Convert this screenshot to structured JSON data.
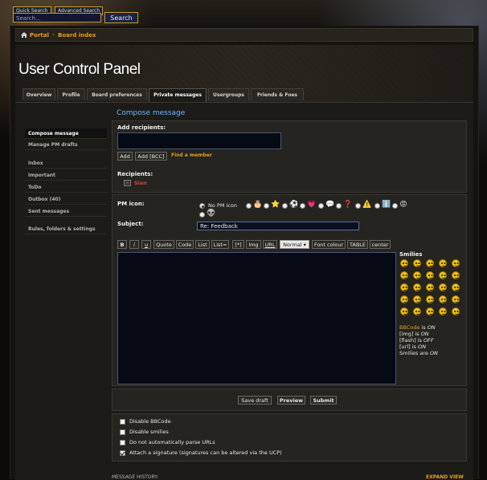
{
  "top": {
    "quick_search": "Quick Search",
    "advanced_search": "Advanced Search",
    "search_placeholder": "Search...",
    "search_button": "Search"
  },
  "breadcrumb": {
    "portal": "Portal",
    "board_index": "Board index",
    "separator": "›"
  },
  "page_title": "User Control Panel",
  "tabs": [
    "Overview",
    "Profile",
    "Board preferences",
    "Private messages",
    "Usergroups",
    "Friends & Foes"
  ],
  "section_title": "Compose message",
  "menu": {
    "compose": "Compose message",
    "manage_drafts": "Manage PM drafts",
    "inbox": "Inbox",
    "important": "Important",
    "todo": "ToDo",
    "outbox": "Outbox (40)",
    "sent": "Sent messages",
    "rules": "Rules, folders & settings"
  },
  "recipients": {
    "add_label": "Add recipients:",
    "add_button": "Add",
    "add_bcc_button": "Add [BCC]",
    "find_member": "Find a member",
    "recipients_label": "Recipients:",
    "recipient_name": "Sian",
    "remove_glyph": "x"
  },
  "compose": {
    "pm_icon_label": "PM icon:",
    "no_pm_icon": "No PM icon",
    "subject_label": "Subject:",
    "subject_value": "Re: Feedback"
  },
  "pm_icons": [
    "🎂",
    "⭐",
    "⚽",
    "💗",
    "💬",
    "❓",
    "⚠️",
    "ℹ️",
    "😡",
    "👽"
  ],
  "format_buttons": {
    "bold": "B",
    "italic": "i",
    "underline": "u",
    "quote": "Quote",
    "code": "Code",
    "list": "List",
    "list_eq": "List=",
    "list_item": "[*]",
    "img": "Img",
    "url": "URL",
    "size_value": "Normal",
    "font_colour": "Font colour",
    "table": "TABLE",
    "center": "center"
  },
  "smilies_label": "Smilies",
  "smilies_count": 25,
  "bbcode_info": {
    "bbcode": "BBCode",
    "is": "is",
    "bbcode_state": "ON",
    "img": "[img] is",
    "img_state": "ON",
    "flash": "[flash] is",
    "flash_state": "OFF",
    "url": "[url] is",
    "url_state": "ON",
    "smilies": "Smilies are",
    "smilies_state": "ON"
  },
  "actions": {
    "save_draft": "Save draft",
    "preview": "Preview",
    "submit": "Submit"
  },
  "options": {
    "disable_bbcode": "Disable BBCode",
    "disable_smilies": "Disable smilies",
    "no_parse_urls": "Do not automatically parse URLs",
    "attach_signature": "Attach a signature (signatures can be altered via the UCP)"
  },
  "footer": {
    "message_history": "MESSAGE HISTORY:",
    "expand_view": "EXPAND VIEW"
  }
}
